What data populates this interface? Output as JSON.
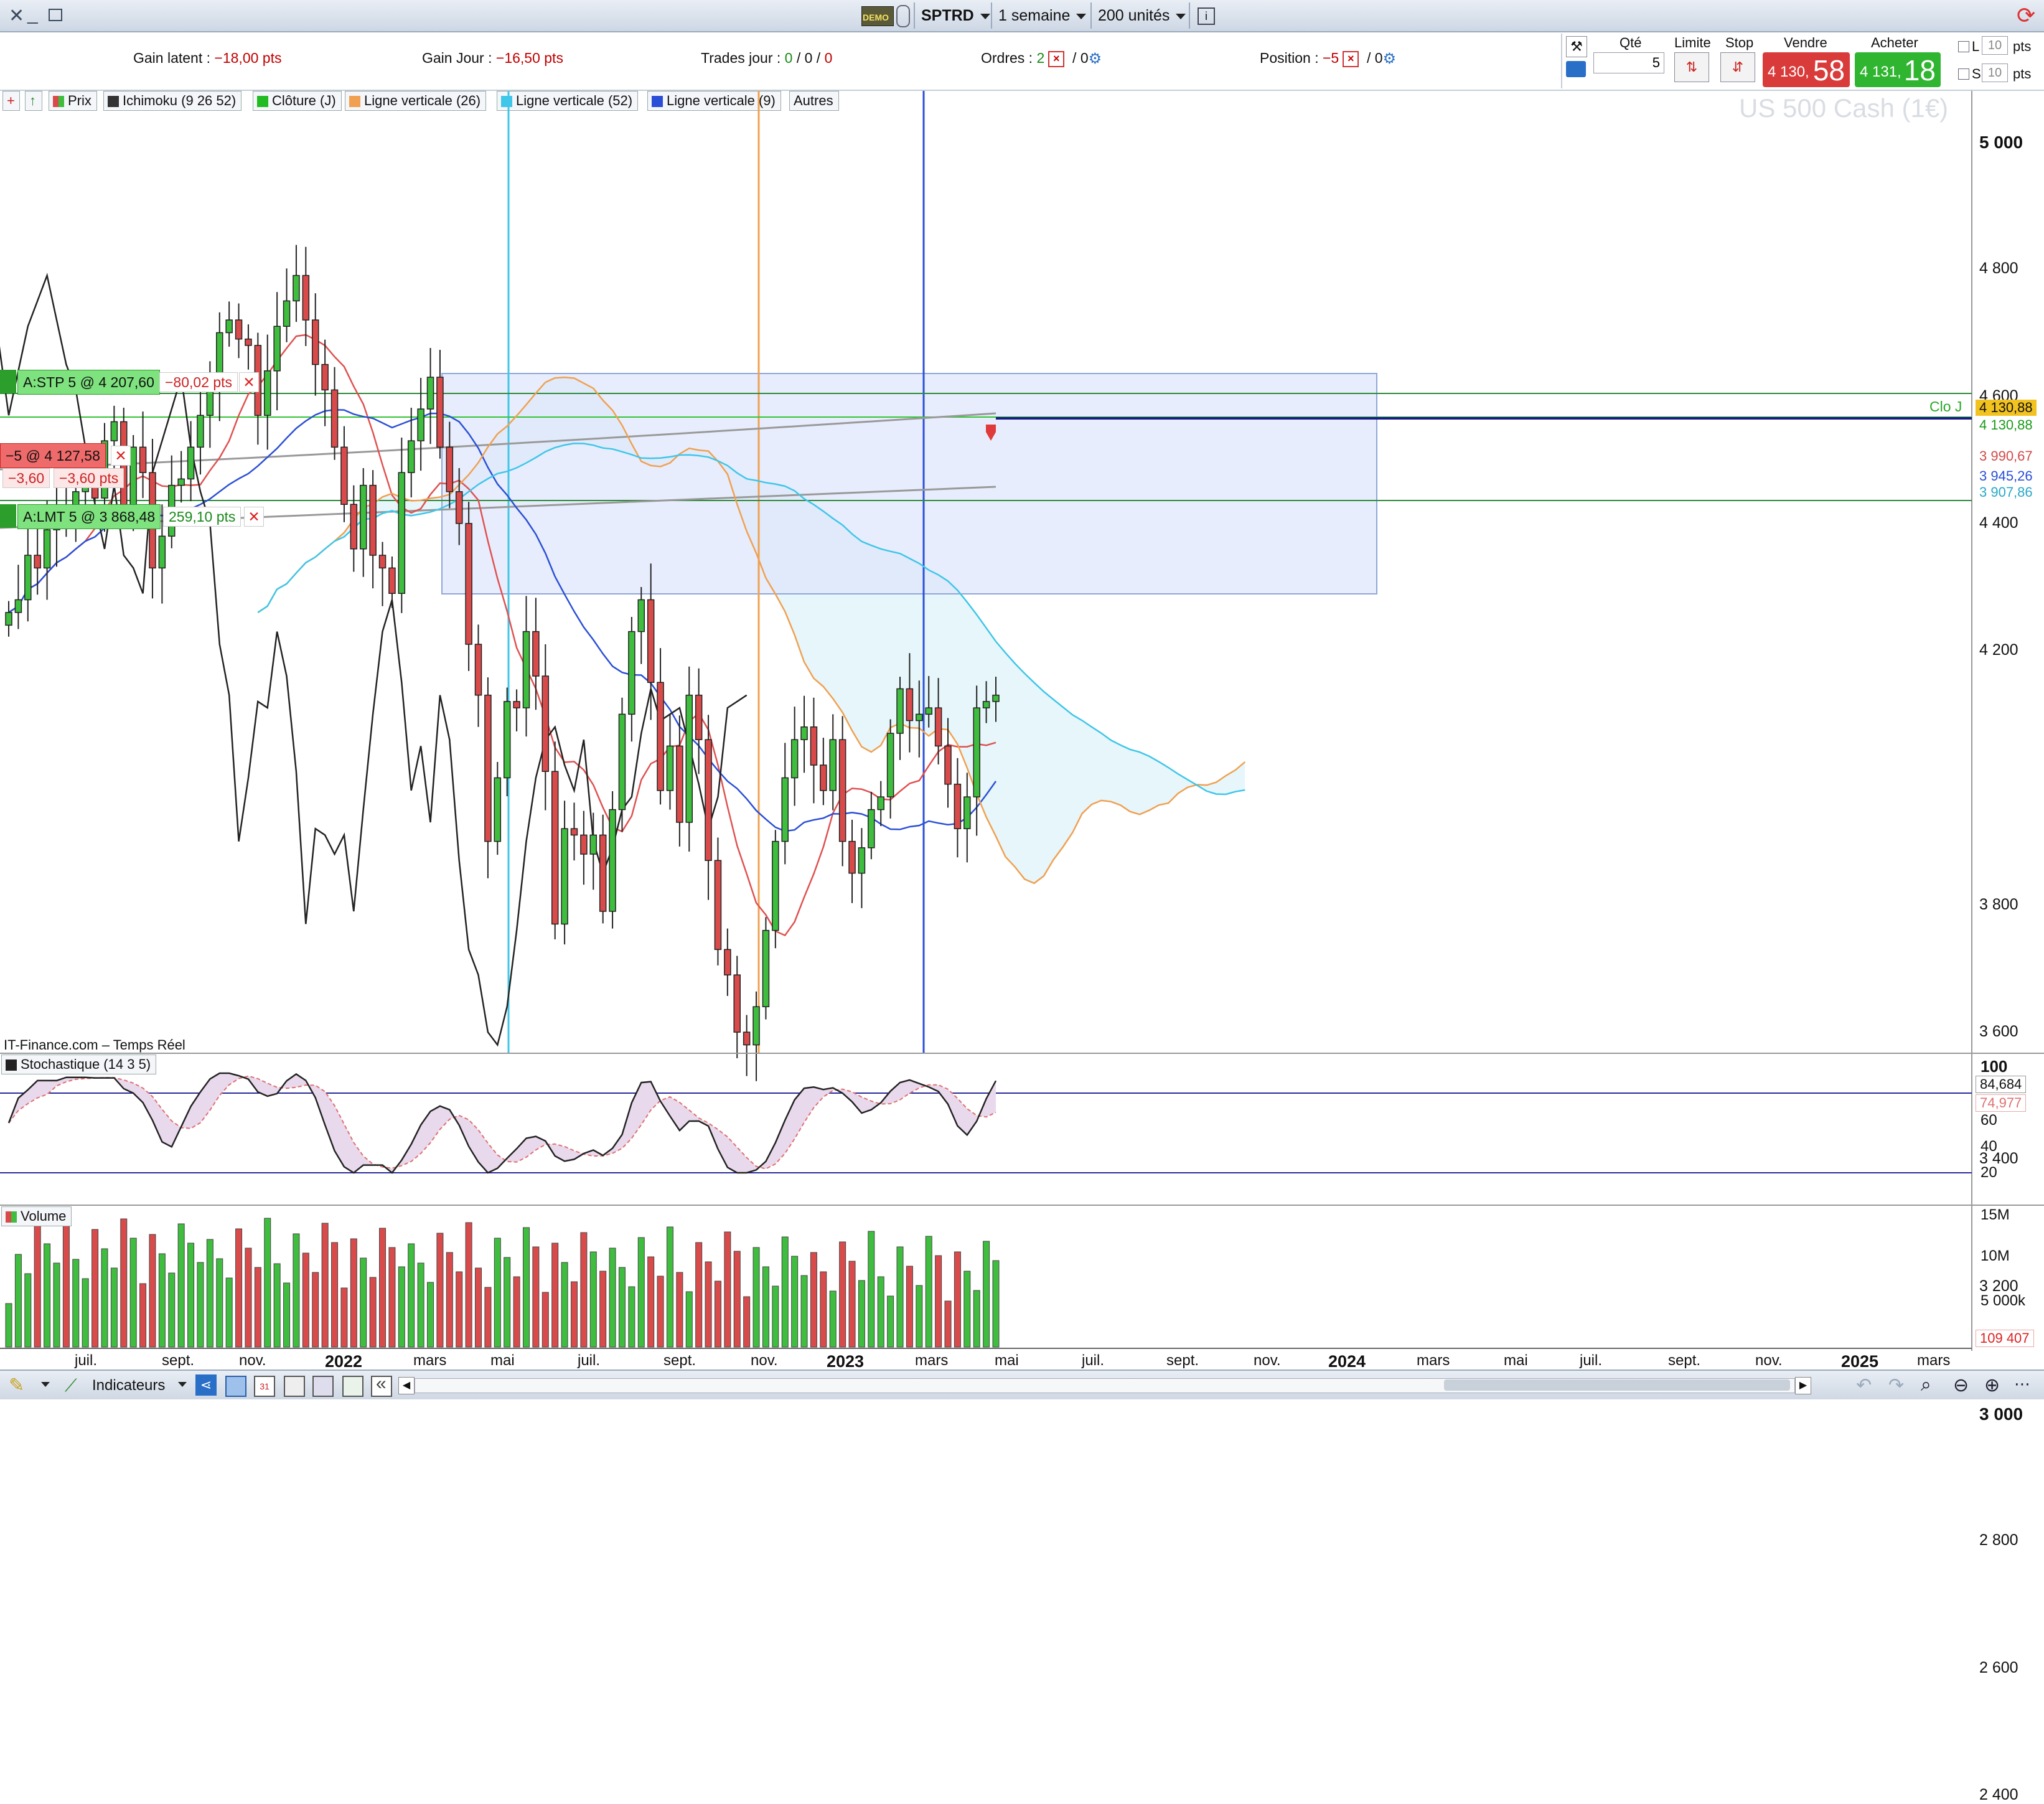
{
  "toolbar": {
    "demo_label": "DEMO",
    "symbol": "SPTRD",
    "period": "1 semaine",
    "units": "200 unités"
  },
  "infobar": {
    "gain_latent_label": "Gain latent :",
    "gain_latent_value": "−18,00 pts",
    "gain_jour_label": "Gain Jour :",
    "gain_jour_value": "−16,50 pts",
    "trades_label": "Trades jour :",
    "trades_a": "0",
    "trades_b": "0",
    "trades_c": "0",
    "ordres_label": "Ordres :",
    "ordres_count": "2",
    "ordres_other": "0",
    "position_label": "Position :",
    "position_value": "−5",
    "position_other": "0"
  },
  "trade_panel": {
    "qty_label": "Qté",
    "qty_value": "5",
    "limit_label": "Limite",
    "stop_label": "Stop",
    "sell_label": "Vendre",
    "sell_small": "4 130,",
    "sell_big": "58",
    "buy_label": "Acheter",
    "buy_small": "4 131,",
    "buy_big": "18",
    "l_label": "L",
    "s_label": "S",
    "l_pts": "10",
    "s_pts": "10",
    "pts": "pts"
  },
  "legend": {
    "items": [
      {
        "label": "Prix",
        "color": "#d94b4b"
      },
      {
        "label": "Ichimoku (9 26 52)",
        "color": "#333333"
      },
      {
        "label": "Clôture (J)",
        "color": "#22bb22"
      },
      {
        "label": "Ligne verticale (26)",
        "color": "#f0a050"
      },
      {
        "label": "Ligne verticale (52)",
        "color": "#3fc6e8"
      },
      {
        "label": "Ligne verticale (9)",
        "color": "#2a4fd6"
      },
      {
        "label": "Autres",
        "color": ""
      }
    ]
  },
  "chart": {
    "watermark": "US 500 Cash (1€)",
    "source": "IT-Finance.com – Temps Réel",
    "clo_label": "Clo J",
    "price_tags": [
      {
        "text": "4 130,88",
        "bg": "#f2c21f",
        "fg": "#111111"
      },
      {
        "text": "4 130,88",
        "bg": "#ffffff",
        "fg": "#1a9a1a"
      },
      {
        "text": "3 990,67",
        "bg": "#ffffff",
        "fg": "#d24a4a"
      },
      {
        "text": "3 945,26",
        "bg": "#ffffff",
        "fg": "#2a4fd6"
      },
      {
        "text": "3 907,86",
        "bg": "#ffffff",
        "fg": "#2aa8c8"
      }
    ],
    "orders": {
      "stop_label": "A:STP  5 @ 4 207,60",
      "stop_pts": "−80,02 pts",
      "pos_label": "−5 @ 4 127,58",
      "pos_a": "−3,60",
      "pos_b": "−3,60 pts",
      "limit_label": "A:LMT  5 @ 3 868,48",
      "limit_pts": "259,10 pts"
    },
    "y_labels": [
      {
        "v": 5000,
        "t": "5 000",
        "bold": true
      },
      {
        "v": 4800,
        "t": "4 800",
        "bold": false
      },
      {
        "v": 4600,
        "t": "4 600",
        "bold": false
      },
      {
        "v": 4400,
        "t": "4 400",
        "bold": false
      },
      {
        "v": 4200,
        "t": "4 200",
        "bold": false
      },
      {
        "v": 3800,
        "t": "3 800",
        "bold": false
      },
      {
        "v": 3600,
        "t": "3 600",
        "bold": false
      },
      {
        "v": 3400,
        "t": "3 400",
        "bold": false
      },
      {
        "v": 3200,
        "t": "3 200",
        "bold": false
      },
      {
        "v": 3000,
        "t": "3 000",
        "bold": true
      },
      {
        "v": 2800,
        "t": "2 800",
        "bold": false
      },
      {
        "v": 2600,
        "t": "2 600",
        "bold": false
      },
      {
        "v": 2400,
        "t": "2 400",
        "bold": false
      }
    ],
    "x_labels": [
      {
        "t": "juil.",
        "bold": false
      },
      {
        "t": "sept.",
        "bold": false
      },
      {
        "t": "nov.",
        "bold": false
      },
      {
        "t": "2022",
        "bold": true
      },
      {
        "t": "mars",
        "bold": false
      },
      {
        "t": "mai",
        "bold": false
      },
      {
        "t": "juil.",
        "bold": false
      },
      {
        "t": "sept.",
        "bold": false
      },
      {
        "t": "nov.",
        "bold": false
      },
      {
        "t": "2023",
        "bold": true
      },
      {
        "t": "mars",
        "bold": false
      },
      {
        "t": "mai",
        "bold": false
      },
      {
        "t": "juil.",
        "bold": false
      },
      {
        "t": "sept.",
        "bold": false
      },
      {
        "t": "nov.",
        "bold": false
      },
      {
        "t": "2024",
        "bold": true
      },
      {
        "t": "mars",
        "bold": false
      },
      {
        "t": "mai",
        "bold": false
      },
      {
        "t": "juil.",
        "bold": false
      },
      {
        "t": "sept.",
        "bold": false
      },
      {
        "t": "nov.",
        "bold": false
      },
      {
        "t": "2025",
        "bold": true
      },
      {
        "t": "mars",
        "bold": false
      }
    ]
  },
  "stochastic": {
    "title": "Stochastique (14 3 5)",
    "labels": [
      "100",
      "60",
      "40",
      "20"
    ],
    "value_k": "84,684",
    "value_d": "74,977"
  },
  "volume": {
    "title": "Volume",
    "labels": [
      "15M",
      "10M",
      "5 000k"
    ],
    "last": "109 407"
  },
  "bottom": {
    "indicators_label": "Indicateurs"
  },
  "chart_data": {
    "type": "candlestick",
    "title": "US 500 Cash (1€)",
    "ylim": [
      2250,
      5050
    ],
    "bar_period": "1 semaine",
    "last_close": 4130.88,
    "close_series": [
      4260,
      4280,
      4350,
      4330,
      4390,
      4420,
      4400,
      4450,
      4470,
      4440,
      4530,
      4560,
      4420,
      4520,
      4480,
      4330,
      4380,
      4460,
      4470,
      4520,
      4570,
      4620,
      4700,
      4720,
      4690,
      4680,
      4570,
      4640,
      4710,
      4750,
      4790,
      4720,
      4650,
      4610,
      4520,
      4430,
      4360,
      4460,
      4350,
      4330,
      4290,
      4480,
      4530,
      4580,
      4630,
      4520,
      4450,
      4400,
      4210,
      4130,
      3900,
      4000,
      4120,
      4110,
      4230,
      4160,
      4010,
      3770,
      3920,
      3910,
      3880,
      3910,
      3790,
      3950,
      4100,
      4230,
      4280,
      4150,
      3980,
      4050,
      3930,
      4130,
      4060,
      3870,
      3730,
      3690,
      3600,
      3580,
      3640,
      3760,
      3900,
      4000,
      4060,
      4080,
      4020,
      3980,
      4060,
      3900,
      3850,
      3890,
      3950,
      3970,
      4070,
      4140,
      4090,
      4100,
      4110,
      4050,
      3990,
      3920,
      3970,
      4110,
      4120,
      4130
    ]
  }
}
